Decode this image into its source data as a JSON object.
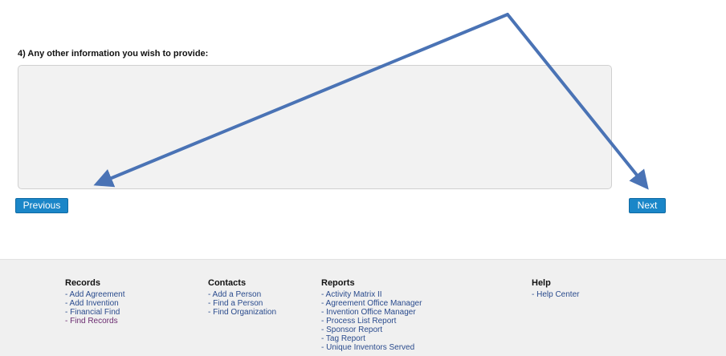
{
  "question": {
    "label": "4) Any other information you wish to provide:",
    "value": ""
  },
  "nav": {
    "previous_label": "Previous",
    "next_label": "Next"
  },
  "footer": {
    "records": {
      "title": "Records",
      "links": [
        "- Add Agreement",
        "- Add Invention",
        "- Financial Find",
        "- Find Records"
      ]
    },
    "contacts": {
      "title": "Contacts",
      "links": [
        "- Add a Person",
        "- Find a Person",
        "- Find Organization"
      ]
    },
    "reports": {
      "title": "Reports",
      "links": [
        "- Activity Matrix II",
        "- Agreement Office Manager",
        "- Invention Office Manager",
        "- Process List Report",
        "- Sponsor Report",
        "- Tag Report",
        "- Unique Inventors Served"
      ]
    },
    "help": {
      "title": "Help",
      "links": [
        "- Help Center"
      ]
    }
  },
  "colors": {
    "button": "#1a86c8",
    "annotation_arrow": "#4a73b5",
    "link": "#2a4b8d",
    "visited_link": "#6a2b6f",
    "footer_bg": "#f0f0f0"
  }
}
